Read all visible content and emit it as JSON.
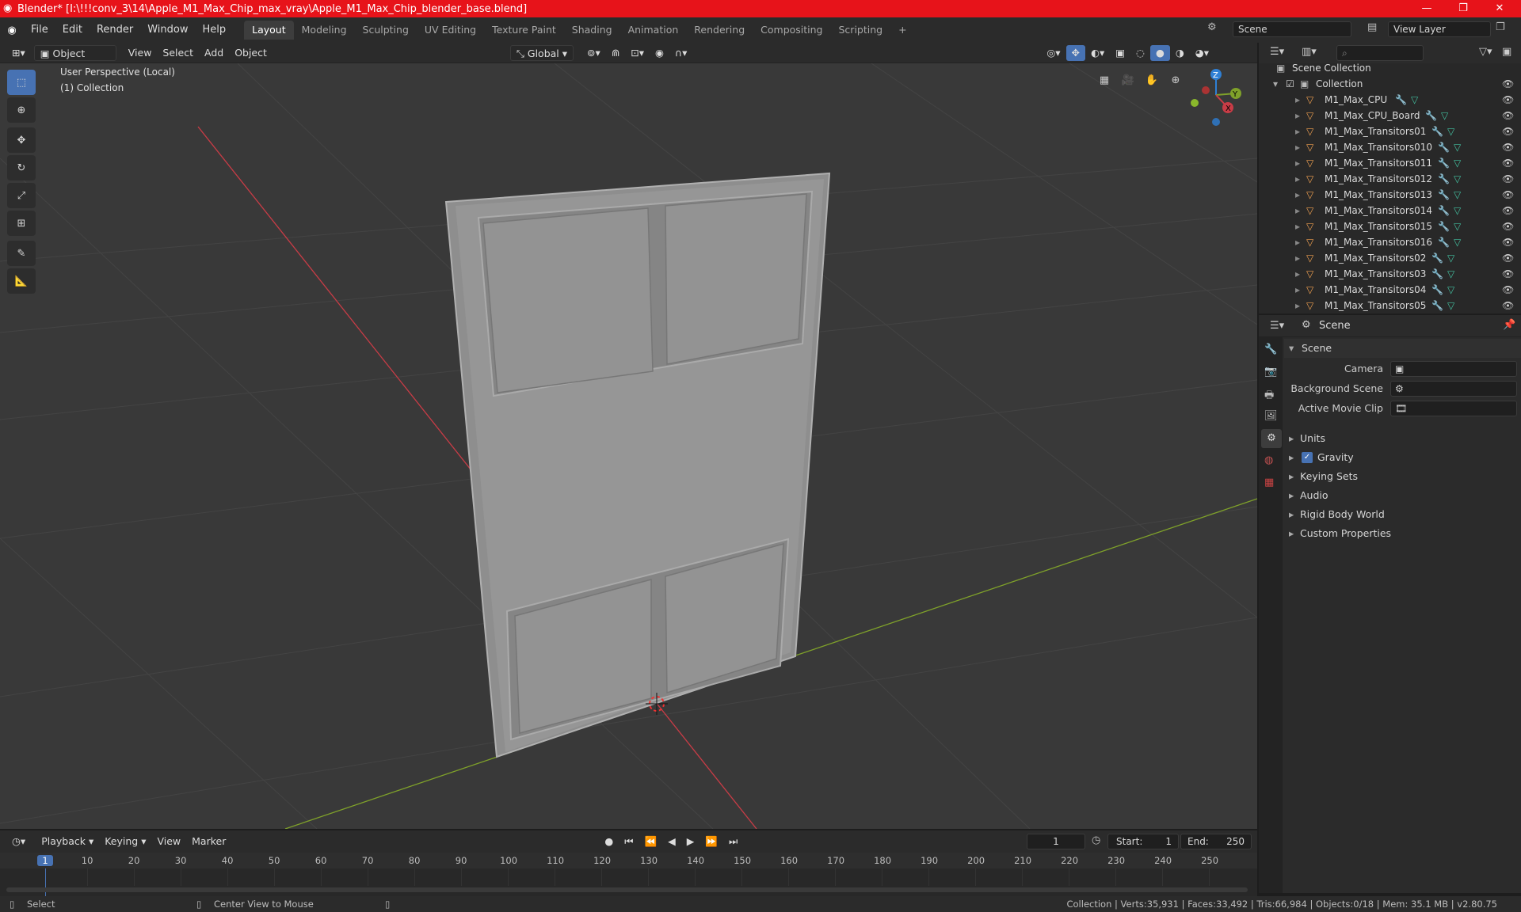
{
  "window": {
    "title": "Blender* [I:\\!!!conv_3\\14\\Apple_M1_Max_Chip_max_vray\\Apple_M1_Max_Chip_blender_base.blend]"
  },
  "menu": [
    "File",
    "Edit",
    "Render",
    "Window",
    "Help"
  ],
  "workspaces": [
    "Layout",
    "Modeling",
    "Sculpting",
    "UV Editing",
    "Texture Paint",
    "Shading",
    "Animation",
    "Rendering",
    "Compositing",
    "Scripting"
  ],
  "active_workspace": "Layout",
  "scene_name": "Scene",
  "view_layer": "View Layer",
  "viewport_header": {
    "mode": "Object Mode",
    "view": "View",
    "select": "Select",
    "add": "Add",
    "object": "Object",
    "orientation": "Global"
  },
  "viewport": {
    "perspective": "User Perspective (Local)",
    "collection": "(1) Collection"
  },
  "gizmo": {
    "z": "Z",
    "y": "Y",
    "x": "X"
  },
  "outliner": {
    "root": "Scene Collection",
    "collection": "Collection",
    "items": [
      "M1_Max_CPU",
      "M1_Max_CPU_Board",
      "M1_Max_Transitors01",
      "M1_Max_Transitors010",
      "M1_Max_Transitors011",
      "M1_Max_Transitors012",
      "M1_Max_Transitors013",
      "M1_Max_Transitors014",
      "M1_Max_Transitors015",
      "M1_Max_Transitors016",
      "M1_Max_Transitors02",
      "M1_Max_Transitors03",
      "M1_Max_Transitors04",
      "M1_Max_Transitors05"
    ]
  },
  "properties": {
    "context": "Scene",
    "panel": "Scene",
    "camera_label": "Camera",
    "bg_label": "Background Scene",
    "clip_label": "Active Movie Clip",
    "sections": [
      "Units",
      "Gravity",
      "Keying Sets",
      "Audio",
      "Rigid Body World",
      "Custom Properties"
    ],
    "gravity_checked": true
  },
  "timeline": {
    "playback": "Playback",
    "keying": "Keying",
    "view": "View",
    "marker": "Marker",
    "current": "1",
    "start_label": "Start:",
    "start": "1",
    "end_label": "End:",
    "end": "250",
    "ticks": [
      "1",
      "10",
      "20",
      "30",
      "40",
      "50",
      "60",
      "70",
      "80",
      "90",
      "100",
      "110",
      "120",
      "130",
      "140",
      "150",
      "160",
      "170",
      "180",
      "190",
      "200",
      "210",
      "220",
      "230",
      "240",
      "250"
    ]
  },
  "status": {
    "left": "Select",
    "middle": "Center View to Mouse",
    "right": "Collection | Verts:35,931 | Faces:33,492 | Tris:66,984 | Objects:0/18 | Mem: 35.1 MB | v2.80.75"
  },
  "colors": {
    "titlebar": "#e7131a",
    "accent": "#4772b3",
    "x_axis": "#c83c46",
    "y_axis": "#7fa12a",
    "z_axis": "#2f80d5"
  }
}
